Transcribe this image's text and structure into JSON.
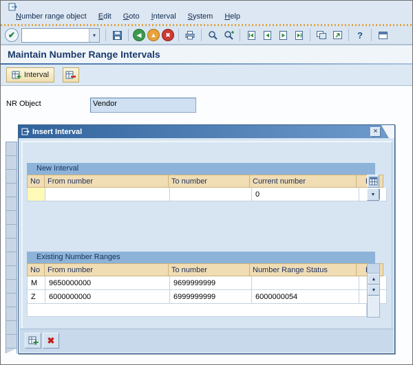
{
  "screen": {
    "menu_items": [
      "Number range object",
      "Edit",
      "Goto",
      "Interval",
      "System",
      "Help"
    ],
    "toolbar_icons": {
      "enter": "✔",
      "back": "◀",
      "exit": "▲",
      "cancel": "✖",
      "help": "?"
    },
    "glyphs": {
      "up": "▲",
      "down": "▼",
      "dropdown": "▾",
      "close": "×"
    },
    "title": "Maintain Number Range Intervals",
    "app_toolbar": {
      "interval_label": "Interval"
    },
    "form": {
      "nr_object_label": "NR Object",
      "nr_object_value": "Vendor"
    },
    "command_value": ""
  },
  "dialog": {
    "title": "Insert Interval",
    "new_interval": {
      "section_title": "New Interval",
      "columns": [
        "No",
        "From number",
        "To number",
        "Current number",
        "Ext"
      ],
      "row": {
        "no": "",
        "from": "",
        "to": "",
        "current": "0",
        "ext": false
      }
    },
    "existing": {
      "section_title": "Existing Number Ranges",
      "columns": [
        "No",
        "From number",
        "To number",
        "Number Range Status",
        "Ext"
      ],
      "rows": [
        {
          "no": "M",
          "from": "9650000000",
          "to": "9699999999",
          "status": "",
          "ext": true
        },
        {
          "no": "Z",
          "from": "6000000000",
          "to": "6999999999",
          "status": "6000000054",
          "ext": false
        }
      ]
    }
  }
}
